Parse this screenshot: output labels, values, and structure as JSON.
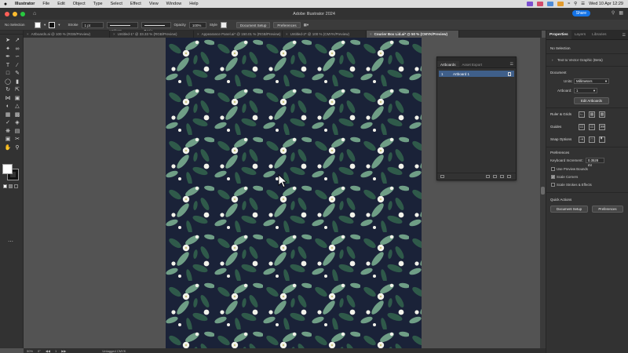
{
  "menubar": {
    "app": "Illustrator",
    "items": [
      "File",
      "Edit",
      "Object",
      "Type",
      "Select",
      "Effect",
      "View",
      "Window",
      "Help"
    ],
    "clock": "Wed 10 Apr  12:29"
  },
  "titlebar": {
    "title": "Adobe Illustrator 2024",
    "share": "Share"
  },
  "controlbar": {
    "selection": "No Selection",
    "stroke_label": "Stroke",
    "stroke_weight": "1 pt",
    "profile": "Uniform",
    "brush": "Basic",
    "opacity_label": "Opacity",
    "opacity": "100%",
    "style_label": "Style",
    "document_setup": "Document Setup",
    "preferences": "Preferences"
  },
  "tabs": [
    {
      "label": "Artboards.ai @ 100 % (RGB/Preview)",
      "active": false
    },
    {
      "label": "Untitled-1* @ 33.33 % (RGB/Preview)",
      "active": false
    },
    {
      "label": "Appearance Panel.ai* @ 150.01 % (RGB/Preview)",
      "active": false
    },
    {
      "label": "Untitled-2* @ 100 % (CMYK/Preview)",
      "active": false
    },
    {
      "label": "Courier Box Lid.ai* @ 50 % (CMYK/Preview)",
      "active": true
    }
  ],
  "artboards_panel": {
    "tab_artboards": "Artboards",
    "tab_asset_export": "Asset Export",
    "rows": [
      {
        "num": "1",
        "name": "Artboard 1"
      }
    ]
  },
  "properties": {
    "tab_properties": "Properties",
    "tab_layers": "Layers",
    "tab_libraries": "Libraries",
    "no_selection": "No Selection",
    "text_to_vector": "Text to Vector Graphic (Beta)",
    "document_heading": "Document",
    "units_label": "Units:",
    "units_value": "Millimeters",
    "artboard_label": "Artboard:",
    "artboard_value": "1",
    "edit_artboards": "Edit Artboards",
    "ruler_grids": "Ruler & Grids",
    "guides": "Guides",
    "snap_options": "Snap Options",
    "preferences_heading": "Preferences",
    "keyboard_increment_label": "Keyboard Increment:",
    "keyboard_increment_value": "0.3528 mr",
    "use_preview_bounds": "Use Preview Bounds",
    "scale_corners": "Scale Corners",
    "scale_strokes": "Scale Strokes & Effects",
    "quick_actions": "Quick Actions",
    "document_setup_btn": "Document Setup",
    "preferences_btn": "Preferences"
  },
  "statusbar": {
    "zoom": "50%",
    "rotation": "0°",
    "artboard": "1",
    "color_mode": "Untagged CMYK"
  },
  "colors": {
    "pattern_bg": "#1a2238",
    "leaf_dark": "#2f5a4a",
    "leaf_light": "#6f9e86",
    "flower": "#f2f2ea",
    "accent_blue": "#1473e6"
  }
}
